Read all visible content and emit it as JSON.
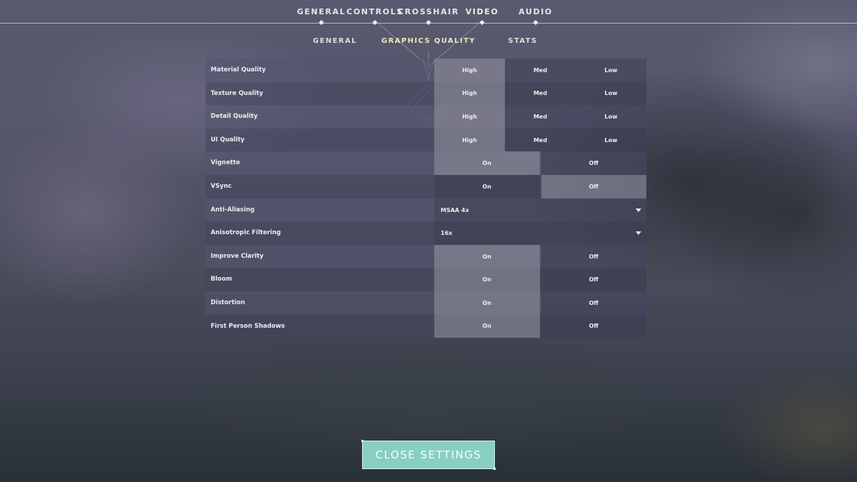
{
  "top_tabs": [
    {
      "label": "GENERAL",
      "active": false
    },
    {
      "label": "CONTROLS",
      "active": false
    },
    {
      "label": "CROSSHAIR",
      "active": false
    },
    {
      "label": "VIDEO",
      "active": true
    },
    {
      "label": "AUDIO",
      "active": false
    }
  ],
  "sub_tabs": [
    {
      "label": "GENERAL",
      "active": false
    },
    {
      "label": "GRAPHICS QUALITY",
      "active": true
    },
    {
      "label": "STATS",
      "active": false
    }
  ],
  "settings": [
    {
      "label": "Material Quality",
      "type": "options",
      "options": [
        "High",
        "Med",
        "Low"
      ],
      "selected": "High"
    },
    {
      "label": "Texture Quality",
      "type": "options",
      "options": [
        "High",
        "Med",
        "Low"
      ],
      "selected": "High"
    },
    {
      "label": "Detail Quality",
      "type": "options",
      "options": [
        "High",
        "Med",
        "Low"
      ],
      "selected": "High"
    },
    {
      "label": "UI Quality",
      "type": "options",
      "options": [
        "High",
        "Med",
        "Low"
      ],
      "selected": "High"
    },
    {
      "label": "Vignette",
      "type": "options",
      "options": [
        "On",
        "Off"
      ],
      "selected": "On"
    },
    {
      "label": "VSync",
      "type": "options",
      "options": [
        "On",
        "Off"
      ],
      "selected": "Off"
    },
    {
      "label": "Anti-Aliasing",
      "type": "dropdown",
      "value": "MSAA 4x"
    },
    {
      "label": "Anisotropic Filtering",
      "type": "dropdown",
      "value": "16x"
    },
    {
      "label": "Improve Clarity",
      "type": "options",
      "options": [
        "On",
        "Off"
      ],
      "selected": "On"
    },
    {
      "label": "Bloom",
      "type": "options",
      "options": [
        "On",
        "Off"
      ],
      "selected": "On"
    },
    {
      "label": "Distortion",
      "type": "options",
      "options": [
        "On",
        "Off"
      ],
      "selected": "On"
    },
    {
      "label": "First Person Shadows",
      "type": "options",
      "options": [
        "On",
        "Off"
      ],
      "selected": "On"
    }
  ],
  "close_button": {
    "label": "CLOSE SETTINGS"
  },
  "colors": {
    "accent": "#88cec2",
    "active_tab": "#ece7b8"
  },
  "icons": {
    "dropdown": "triangle-down-icon",
    "nav_marker": "diamond-icon"
  }
}
